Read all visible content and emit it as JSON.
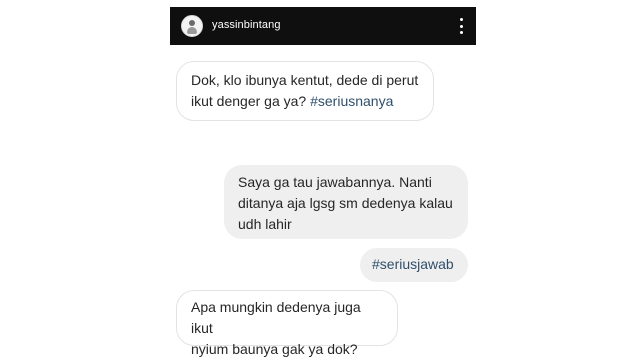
{
  "header": {
    "username": "yassinbintang",
    "avatar_icon": "avatar-icon",
    "menu_icon": "more-vertical-icon"
  },
  "messages": [
    {
      "direction": "incoming",
      "text": "Dok, klo ibunya kentut, dede di perut\nikut denger ga ya? ",
      "hashtag": "#seriusnanya"
    },
    {
      "direction": "outgoing",
      "text": "Saya ga tau jawabannya. Nanti\nditanya aja lgsg sm dedenya kalau\nudh lahir",
      "hashtag": ""
    },
    {
      "direction": "outgoing",
      "text": "",
      "hashtag": "#seriusjawab"
    },
    {
      "direction": "incoming",
      "text": "Apa mungkin dedenya juga ikut\nnyium baunya gak ya dok?",
      "hashtag": ""
    }
  ],
  "colors": {
    "header_bg": "#0f0f0f",
    "incoming_bg": "#ffffff",
    "outgoing_bg": "#efefef",
    "hashtag": "#2f4f6a"
  }
}
